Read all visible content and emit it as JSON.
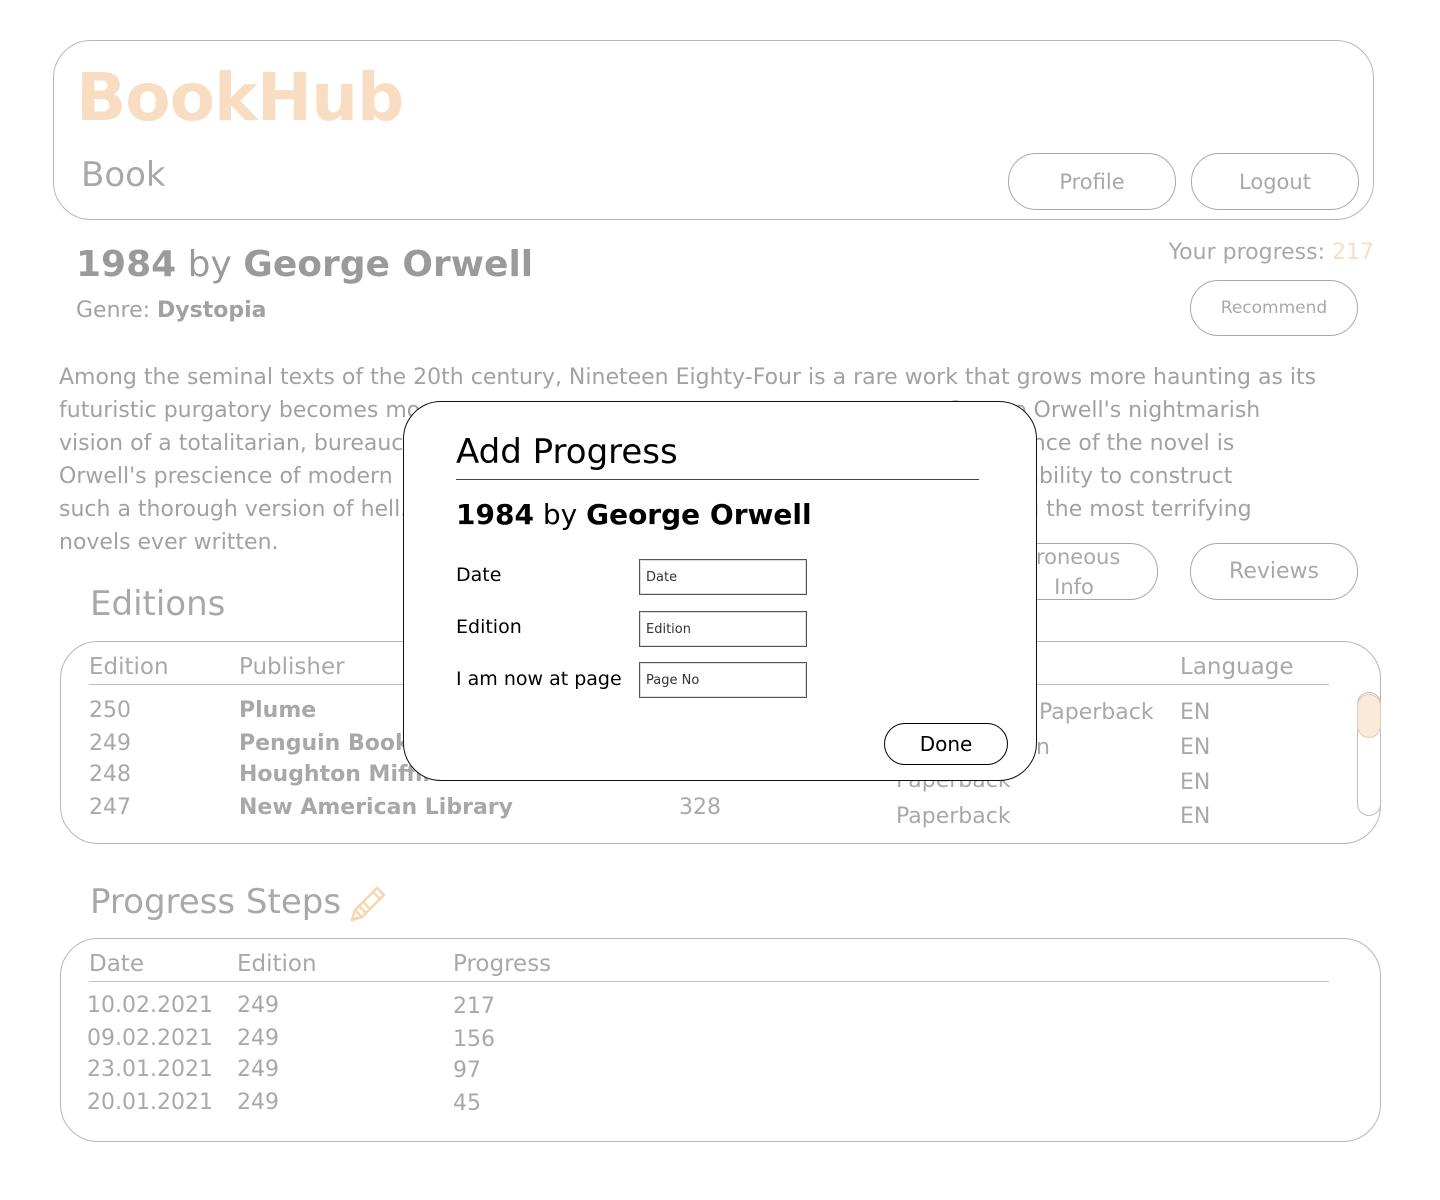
{
  "header": {
    "logo": "BookHub",
    "subtitle": "Book",
    "profile_label": "Profile",
    "logout_label": "Logout"
  },
  "book": {
    "title": "1984",
    "by": "by",
    "author": "George Orwell",
    "genre_label": "Genre:",
    "genre": "Dystopia",
    "progress_label": "Your progress:",
    "progress_value": "217",
    "recommend_label": "Recommend",
    "description_lines": [
      "Among the seminal texts of the 20th century, Nineteen Eighty-Four is a rare work that grows more haunting as its",
      "futuristic purgatory becomes mo                                                                         t George Orwell's nightmarish",
      "vision of a totalitarian, bureaucr                                                                         The brilliance of the novel is",
      "Orwell's prescience of modern                                                                         e—and his ability to construct",
      "such a thorough version of hell.                                                                         nks among the most terrifying",
      "novels ever written."
    ],
    "erroneous_label_1": "rroneous",
    "erroneous_label_2": "Info",
    "reviews_label": "Reviews"
  },
  "editions": {
    "title": "Editions",
    "columns": [
      "Edition",
      "Publisher",
      "Language"
    ],
    "rows": [
      {
        "edition": "250",
        "publisher": "Plume",
        "format": "Paperback",
        "language": "EN"
      },
      {
        "edition": "249",
        "publisher": "Penguin Book",
        "format": "n",
        "language": "EN"
      },
      {
        "edition": "248",
        "publisher": "Houghton Miffli",
        "pages": "",
        "format": "Paperback",
        "language": "EN"
      },
      {
        "edition": "247",
        "publisher": "New American Library",
        "pages": "328",
        "format": "Paperback",
        "language": "EN"
      }
    ]
  },
  "progress_steps": {
    "title": "Progress Steps",
    "columns": [
      "Date",
      "Edition",
      "Progress"
    ],
    "rows": [
      {
        "date": "10.02.2021",
        "edition": "249",
        "progress": "217"
      },
      {
        "date": "09.02.2021",
        "edition": "249",
        "progress": "156"
      },
      {
        "date": "23.01.2021",
        "edition": "249",
        "progress": "97"
      },
      {
        "date": "20.01.2021",
        "edition": "249",
        "progress": "45"
      }
    ]
  },
  "modal": {
    "title": "Add Progress",
    "book_title": "1984",
    "by": "by",
    "book_author": "George Orwell",
    "date_label": "Date",
    "date_placeholder": "Date",
    "edition_label": "Edition",
    "edition_placeholder": "Edition",
    "page_label": "I am now at page",
    "page_placeholder": "Page No",
    "done_label": "Done"
  },
  "colors": {
    "accent": "#f0b070",
    "text": "#333333",
    "modal_border": "#111111"
  },
  "icons": {
    "edit": "pencil-icon"
  }
}
